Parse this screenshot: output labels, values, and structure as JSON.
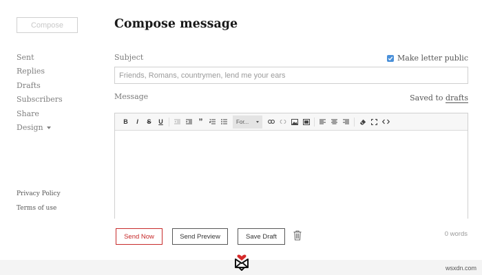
{
  "sidebar": {
    "compose_label": "Compose",
    "items": [
      {
        "label": "Sent"
      },
      {
        "label": "Replies"
      },
      {
        "label": "Drafts"
      },
      {
        "label": "Subscribers"
      },
      {
        "label": "Share"
      },
      {
        "label": "Design"
      }
    ],
    "footer_links": [
      {
        "label": "Privacy Policy"
      },
      {
        "label": "Terms of use"
      }
    ]
  },
  "main": {
    "title": "Compose message",
    "subject_label": "Subject",
    "make_public_label": "Make letter public",
    "make_public_checked": true,
    "subject_value": "",
    "subject_placeholder": "Friends, Romans, countrymen, lend me your ears",
    "message_label": "Message",
    "saved_prefix": "Saved to",
    "saved_link": "drafts",
    "toolbar": {
      "bold": "B",
      "italic": "I",
      "strike": "S",
      "underline": "U",
      "quote": "”",
      "format_label": "For..."
    },
    "word_count": "0 words"
  },
  "actions": {
    "send_now": "Send Now",
    "send_preview": "Send Preview",
    "save_draft": "Save Draft"
  },
  "watermark": "wsxdn.com",
  "colors": {
    "accent_red": "#c62828",
    "checkbox_blue": "#4a90d9",
    "logo_heart": "#d62b2b"
  }
}
